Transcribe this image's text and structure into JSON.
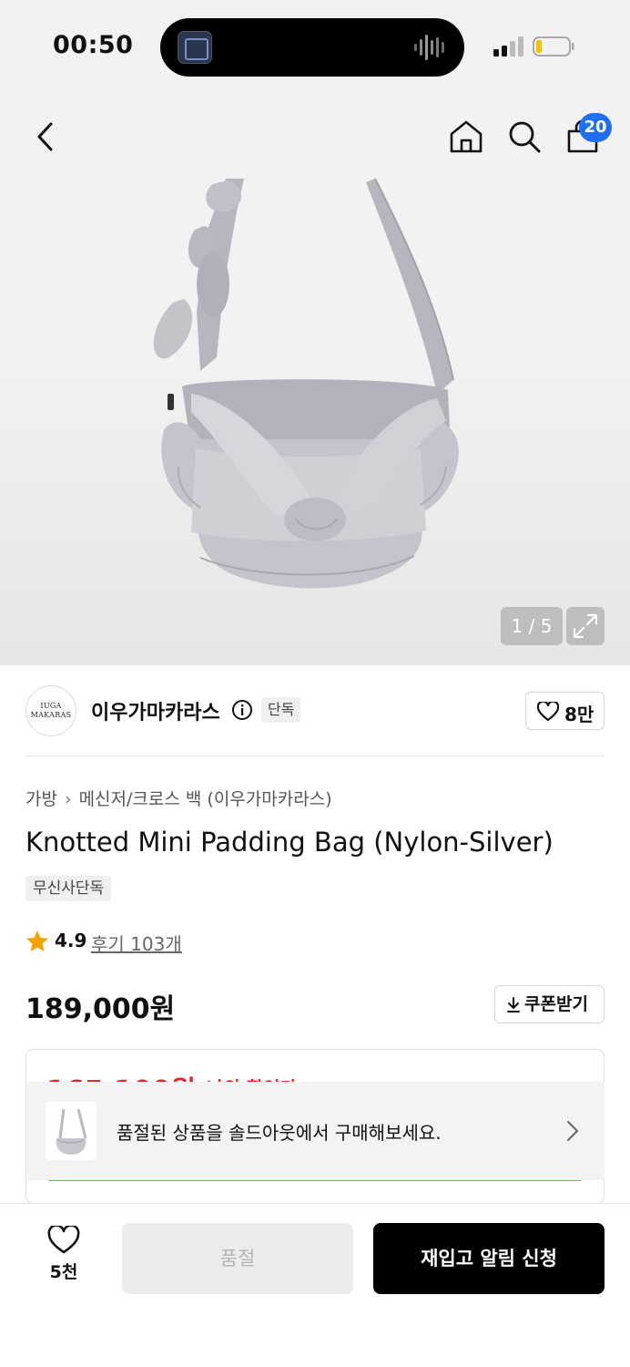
{
  "status_bar": {
    "time": "00:50"
  },
  "header": {
    "back_icon": "chevron-left-icon",
    "home_icon": "home-icon",
    "search_icon": "search-icon",
    "cart_icon": "shopping-bag-icon",
    "cart_count": "20",
    "badge_color": "#1f6ff2"
  },
  "gallery": {
    "counter": "1 / 5",
    "expand_icon": "expand-icon"
  },
  "brand": {
    "logo_line1": "IUGA",
    "logo_line2": "MAKARAS",
    "name": "이우가마카라스",
    "info_icon": "info-icon",
    "tag": "단독",
    "likes": "8만"
  },
  "product": {
    "breadcrumb": [
      "가방",
      "메신저/크로스 백 (이우가마카라스)"
    ],
    "title": "Knotted Mini Padding Bag (Nylon-Silver)",
    "exclusive_tag": "무신사단독",
    "rating": "4.9",
    "reviews_label": "후기 103개",
    "price": "189,000원",
    "coupon_label": "쿠폰받기"
  },
  "discount": {
    "price": "165,100원",
    "label": "나의 할인가",
    "accent_color": "#e5232b"
  },
  "soldout_banner": {
    "text": "품절된 상품을 솔드아웃에서 구매해보세요."
  },
  "bottom_bar": {
    "wish_count": "5천",
    "soldout_label": "품절",
    "restock_label": "재입고 알림 신청"
  }
}
